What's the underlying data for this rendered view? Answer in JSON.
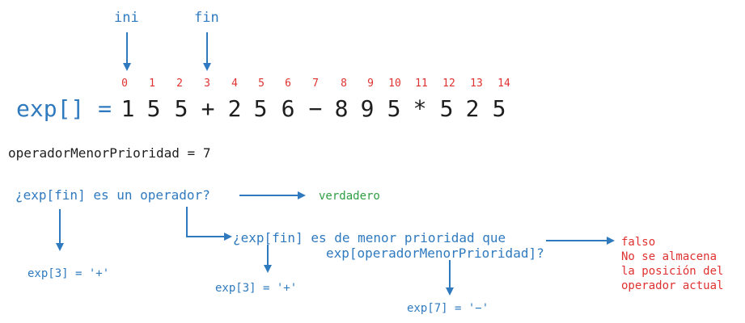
{
  "pointers": {
    "ini": "ini",
    "fin": "fin"
  },
  "indices": [
    "0",
    "1",
    "2",
    "3",
    "4",
    "5",
    "6",
    "7",
    "8",
    "9",
    "10",
    "11",
    "12",
    "13",
    "14"
  ],
  "expression": {
    "label": "exp[] =",
    "tokens": [
      "1",
      "5",
      "5",
      "+",
      "2",
      "5",
      "6",
      "−",
      "8",
      "9",
      "5",
      "*",
      "5",
      "2",
      "5"
    ]
  },
  "assignment": "operadorMenorPrioridad = 7",
  "question1": "¿exp[fin] es un operador?",
  "answer1": "verdadero",
  "value_left": "exp[3] = '+'",
  "question2_line1": "¿exp[fin] es de menor prioridad que",
  "question2_line2": "exp[operadorMenorPrioridad]?",
  "value_mid": "exp[3] = '+'",
  "value_right": "exp[7] = '−'",
  "answer2": [
    "falso",
    "No se almacena",
    "la posición del",
    "operador actual"
  ],
  "colors": {
    "blue": "#2f7abf",
    "red": "#e03131",
    "green": "#2f9e44",
    "black": "#1e1e1e"
  }
}
